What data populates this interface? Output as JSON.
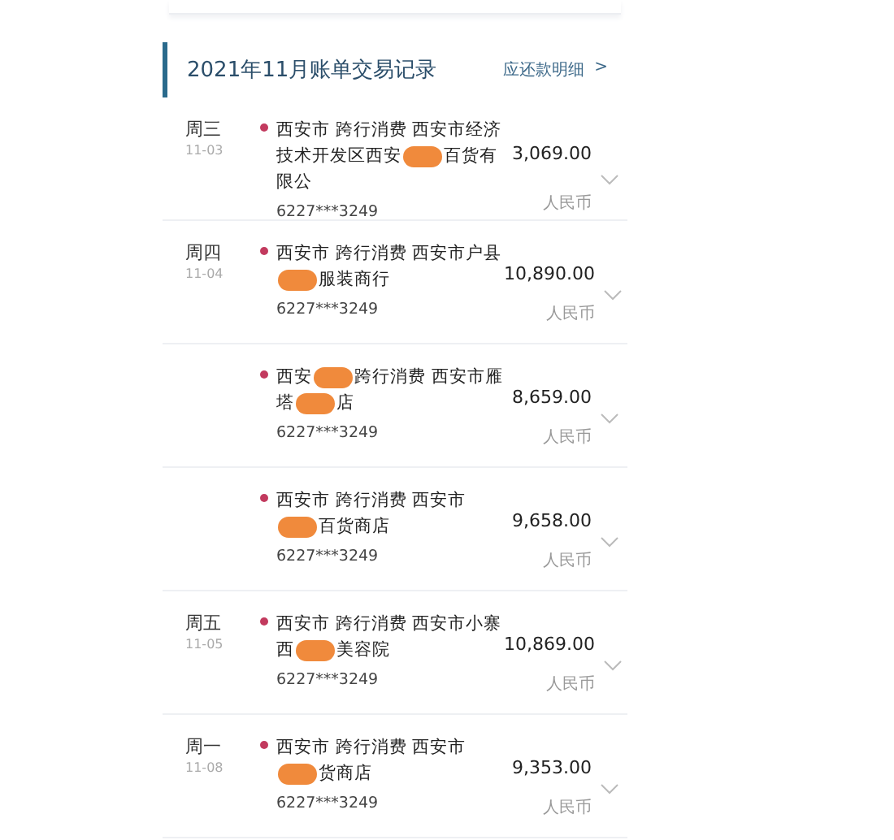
{
  "header": {
    "title": "2021年11月账单交易记录",
    "link": "应还款明细",
    "link_arrow": ">"
  },
  "transactions": [
    {
      "day": "周三",
      "date": "11-03",
      "parts": [
        {
          "kind": "text",
          "text": "西安市 跨行消费 西安市经济技术开发区西安"
        },
        {
          "kind": "redaction"
        },
        {
          "kind": "text",
          "text": "百货有限公"
        }
      ],
      "card": "6227***3249",
      "amount": "3,069.00",
      "currency": "人民币"
    },
    {
      "day": "周四",
      "date": "11-04",
      "parts": [
        {
          "kind": "text",
          "text": "西安市 跨行消费 西安市户县"
        },
        {
          "kind": "redaction"
        },
        {
          "kind": "text",
          "text": "服装商行"
        }
      ],
      "card": "6227***3249",
      "amount": "10,890.00",
      "currency": "人民币"
    },
    {
      "parts": [
        {
          "kind": "text",
          "text": "西安"
        },
        {
          "kind": "redaction"
        },
        {
          "kind": "text",
          "text": "跨行消费 西安市雁塔"
        },
        {
          "kind": "redaction"
        },
        {
          "kind": "text",
          "text": "店"
        }
      ],
      "card": "6227***3249",
      "amount": "8,659.00",
      "currency": "人民币"
    },
    {
      "parts": [
        {
          "kind": "text",
          "text": "西安市 跨行消费 西安市"
        },
        {
          "kind": "redaction"
        },
        {
          "kind": "text",
          "text": "百货商店"
        }
      ],
      "card": "6227***3249",
      "amount": "9,658.00",
      "currency": "人民币"
    },
    {
      "day": "周五",
      "date": "11-05",
      "parts": [
        {
          "kind": "text",
          "text": "西安市 跨行消费 西安市小寨西"
        },
        {
          "kind": "redaction"
        },
        {
          "kind": "text",
          "text": "美容院"
        }
      ],
      "card": "6227***3249",
      "amount": "10,869.00",
      "currency": "人民币"
    },
    {
      "day": "周一",
      "date": "11-08",
      "parts": [
        {
          "kind": "text",
          "text": "西安市 跨行消费 西安市"
        },
        {
          "kind": "redaction"
        },
        {
          "kind": "text",
          "text": "货商店"
        }
      ],
      "card": "6227***3249",
      "amount": "9,353.00",
      "currency": "人民币"
    }
  ]
}
